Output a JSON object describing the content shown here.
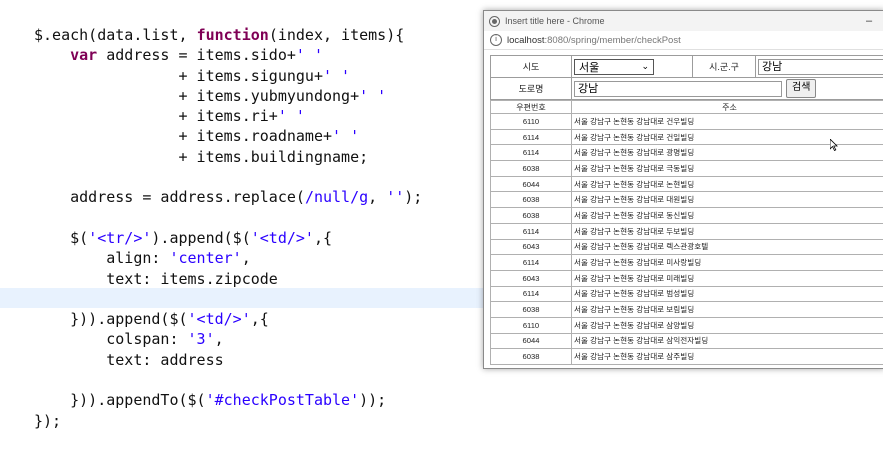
{
  "code_lines": [
    [
      {
        "t": "$.each(data.list, "
      },
      {
        "t": "function",
        "c": "kw"
      },
      {
        "t": "(index, items){"
      }
    ],
    [
      {
        "t": "    "
      },
      {
        "t": "var",
        "c": "kw"
      },
      {
        "t": " address = items.sido+"
      },
      {
        "t": "' '",
        "c": "st"
      }
    ],
    [
      {
        "t": "                + items.sigungu+"
      },
      {
        "t": "' '",
        "c": "st"
      }
    ],
    [
      {
        "t": "                + items.yubmyundong+"
      },
      {
        "t": "' '",
        "c": "st"
      }
    ],
    [
      {
        "t": "                + items.ri+"
      },
      {
        "t": "' '",
        "c": "st"
      }
    ],
    [
      {
        "t": "                + items.roadname+"
      },
      {
        "t": "' '",
        "c": "st"
      }
    ],
    [
      {
        "t": "                + items.buildingname;"
      }
    ],
    [
      {
        "t": ""
      }
    ],
    [
      {
        "t": "    address = address.replace("
      },
      {
        "t": "/null/g",
        "c": "st"
      },
      {
        "t": ", "
      },
      {
        "t": "''",
        "c": "st"
      },
      {
        "t": ");"
      }
    ],
    [
      {
        "t": ""
      }
    ],
    [
      {
        "t": "    $("
      },
      {
        "t": "'<tr/>'",
        "c": "st"
      },
      {
        "t": ").append($("
      },
      {
        "t": "'<td/>'",
        "c": "st"
      },
      {
        "t": ",{"
      }
    ],
    [
      {
        "t": "        align: "
      },
      {
        "t": "'center'",
        "c": "st"
      },
      {
        "t": ","
      }
    ],
    [
      {
        "t": "        text: items.zipcode"
      }
    ],
    [
      {
        "t": ""
      }
    ],
    [
      {
        "t": "    })).append($("
      },
      {
        "t": "'<td/>'",
        "c": "st"
      },
      {
        "t": ",{"
      }
    ],
    [
      {
        "t": "        colspan: "
      },
      {
        "t": "'3'",
        "c": "st"
      },
      {
        "t": ","
      }
    ],
    [
      {
        "t": "        text: address"
      }
    ],
    [
      {
        "t": ""
      }
    ],
    [
      {
        "t": "    })).appendTo($("
      },
      {
        "t": "'#checkPostTable'",
        "c": "st"
      },
      {
        "t": "));"
      }
    ],
    [
      {
        "t": "});"
      }
    ]
  ],
  "window": {
    "title": "Insert title here - Chrome",
    "minimize": "–",
    "url_host": "localhost",
    "url_path": ":8080/spring/member/checkPost"
  },
  "form": {
    "sido_label": "시도",
    "sido_value": "서울",
    "sigungu_label": "시.군.구",
    "sigungu_value": "강남",
    "road_label": "도로명",
    "road_value": "강남",
    "search_button": "검색"
  },
  "results": {
    "headers": [
      "우편번호",
      "주소"
    ],
    "rows": [
      [
        "6110",
        "서울 강남구 논현동 강남대로 건우빌딩"
      ],
      [
        "6114",
        "서울 강남구 논현동 강남대로 건일빌딩"
      ],
      [
        "6114",
        "서울 강남구 논현동 강남대로 광명빌딩"
      ],
      [
        "6038",
        "서울 강남구 논현동 강남대로 극동빌딩"
      ],
      [
        "6044",
        "서울 강남구 논현동 강남대로 논현빌딩"
      ],
      [
        "6038",
        "서울 강남구 논현동 강남대로 대원빌딩"
      ],
      [
        "6038",
        "서울 강남구 논현동 강남대로 동신빌딩"
      ],
      [
        "6114",
        "서울 강남구 논현동 강남대로 두보빌딩"
      ],
      [
        "6043",
        "서울 강남구 논현동 강남대로 렉스관광호텔"
      ],
      [
        "6114",
        "서울 강남구 논현동 강남대로 미사랑빌딩"
      ],
      [
        "6043",
        "서울 강남구 논현동 강남대로 미래빌딩"
      ],
      [
        "6114",
        "서울 강남구 논현동 강남대로 범성빌딩"
      ],
      [
        "6038",
        "서울 강남구 논현동 강남대로 보림빌딩"
      ],
      [
        "6110",
        "서울 강남구 논현동 강남대로 삼양빌딩"
      ],
      [
        "6044",
        "서울 강남구 논현동 강남대로 삼익전자빌딩"
      ],
      [
        "6038",
        "서울 강남구 논현동 강남대로 삼주빌딩"
      ]
    ]
  }
}
